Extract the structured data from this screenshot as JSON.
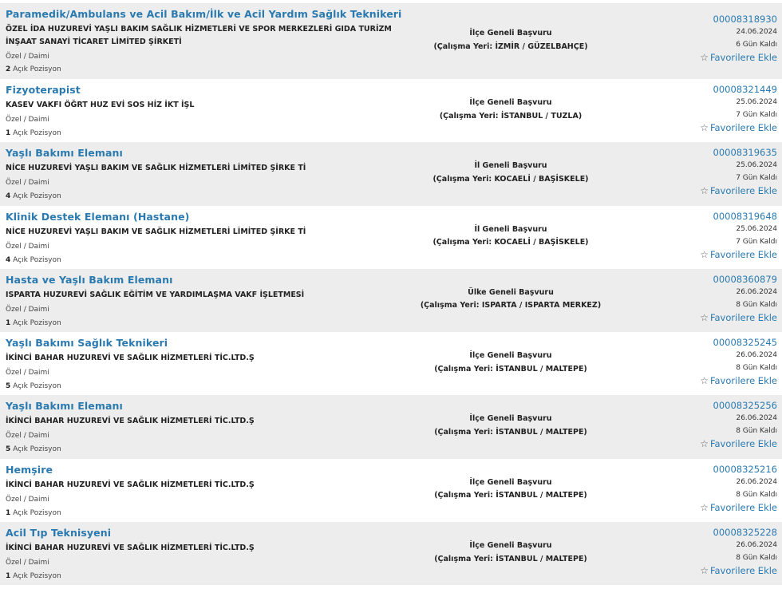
{
  "listing": {
    "type_label": "Özel / Daimi",
    "positions_suffix": "Açık Pozisyon",
    "favorite_label": "Favorilere Ekle",
    "jobs": [
      {
        "title": "Paramedik/Ambulans ve Acil Bakım/İlk ve Acil Yardım Sağlık Teknikeri",
        "company": "ÖZEL İDA HUZUREVİ YAŞLI BAKIM SAĞLIK HİZMETLERİ VE SPOR MERKEZLERİ GIDA TURİZM İNŞAAT SANAYİ TİCARET LİMİTED ŞİRKETİ",
        "positions": "2",
        "scope": "İlçe Geneli Başvuru",
        "location": "(Çalışma Yeri: İZMİR / GÜZELBAHÇE)",
        "job_no": "00008318930",
        "date": "24.06.2024",
        "days_left": "6 Gün Kaldı"
      },
      {
        "title": "Fizyoterapist",
        "company": "KASEV VAKFI ÖĞRT HUZ EVİ SOS HİZ İKT İŞL",
        "positions": "1",
        "scope": "İlçe Geneli Başvuru",
        "location": "(Çalışma Yeri: İSTANBUL / TUZLA)",
        "job_no": "00008321449",
        "date": "25.06.2024",
        "days_left": "7 Gün Kaldı"
      },
      {
        "title": "Yaşlı Bakımı Elemanı",
        "company": "NİCE HUZUREVİ YAŞLI BAKIM VE SAĞLIK HİZMETLERİ LİMİTED ŞİRKE Tİ",
        "positions": "4",
        "scope": "İl Geneli Başvuru",
        "location": "(Çalışma Yeri: KOCAELİ / BAŞİSKELE)",
        "job_no": "00008319635",
        "date": "25.06.2024",
        "days_left": "7 Gün Kaldı"
      },
      {
        "title": "Klinik Destek Elemanı (Hastane)",
        "company": "NİCE HUZUREVİ YAŞLI BAKIM VE SAĞLIK HİZMETLERİ LİMİTED ŞİRKE Tİ",
        "positions": "4",
        "scope": "İl Geneli Başvuru",
        "location": "(Çalışma Yeri: KOCAELİ / BAŞİSKELE)",
        "job_no": "00008319648",
        "date": "25.06.2024",
        "days_left": "7 Gün Kaldı"
      },
      {
        "title": "Hasta ve Yaşlı Bakım Elemanı",
        "company": "ISPARTA HUZUREVİ SAĞLIK EĞİTİM VE YARDIMLAŞMA VAKF İŞLETMESİ",
        "positions": "1",
        "scope": "Ülke Geneli Başvuru",
        "location": "(Çalışma Yeri: ISPARTA / ISPARTA MERKEZ)",
        "job_no": "00008360879",
        "date": "26.06.2024",
        "days_left": "8 Gün Kaldı"
      },
      {
        "title": "Yaşlı Bakımı Sağlık Teknikeri",
        "company": "İKİNCİ BAHAR HUZUREVİ VE SAĞLIK HİZMETLERİ TİC.LTD.Ş",
        "positions": "5",
        "scope": "İlçe Geneli Başvuru",
        "location": "(Çalışma Yeri: İSTANBUL / MALTEPE)",
        "job_no": "00008325245",
        "date": "26.06.2024",
        "days_left": "8 Gün Kaldı"
      },
      {
        "title": "Yaşlı Bakımı Elemanı",
        "company": "İKİNCİ BAHAR HUZUREVİ VE SAĞLIK HİZMETLERİ TİC.LTD.Ş",
        "positions": "5",
        "scope": "İlçe Geneli Başvuru",
        "location": "(Çalışma Yeri: İSTANBUL / MALTEPE)",
        "job_no": "00008325256",
        "date": "26.06.2024",
        "days_left": "8 Gün Kaldı"
      },
      {
        "title": "Hemşire",
        "company": "İKİNCİ BAHAR HUZUREVİ VE SAĞLIK HİZMETLERİ TİC.LTD.Ş",
        "positions": "1",
        "scope": "İlçe Geneli Başvuru",
        "location": "(Çalışma Yeri: İSTANBUL / MALTEPE)",
        "job_no": "00008325216",
        "date": "26.06.2024",
        "days_left": "8 Gün Kaldı"
      },
      {
        "title": "Acil Tıp Teknisyeni",
        "company": "İKİNCİ BAHAR HUZUREVİ VE SAĞLIK HİZMETLERİ TİC.LTD.Ş",
        "positions": "1",
        "scope": "İlçe Geneli Başvuru",
        "location": "(Çalışma Yeri: İSTANBUL / MALTEPE)",
        "job_no": "00008325228",
        "date": "26.06.2024",
        "days_left": "8 Gün Kaldı"
      }
    ]
  }
}
